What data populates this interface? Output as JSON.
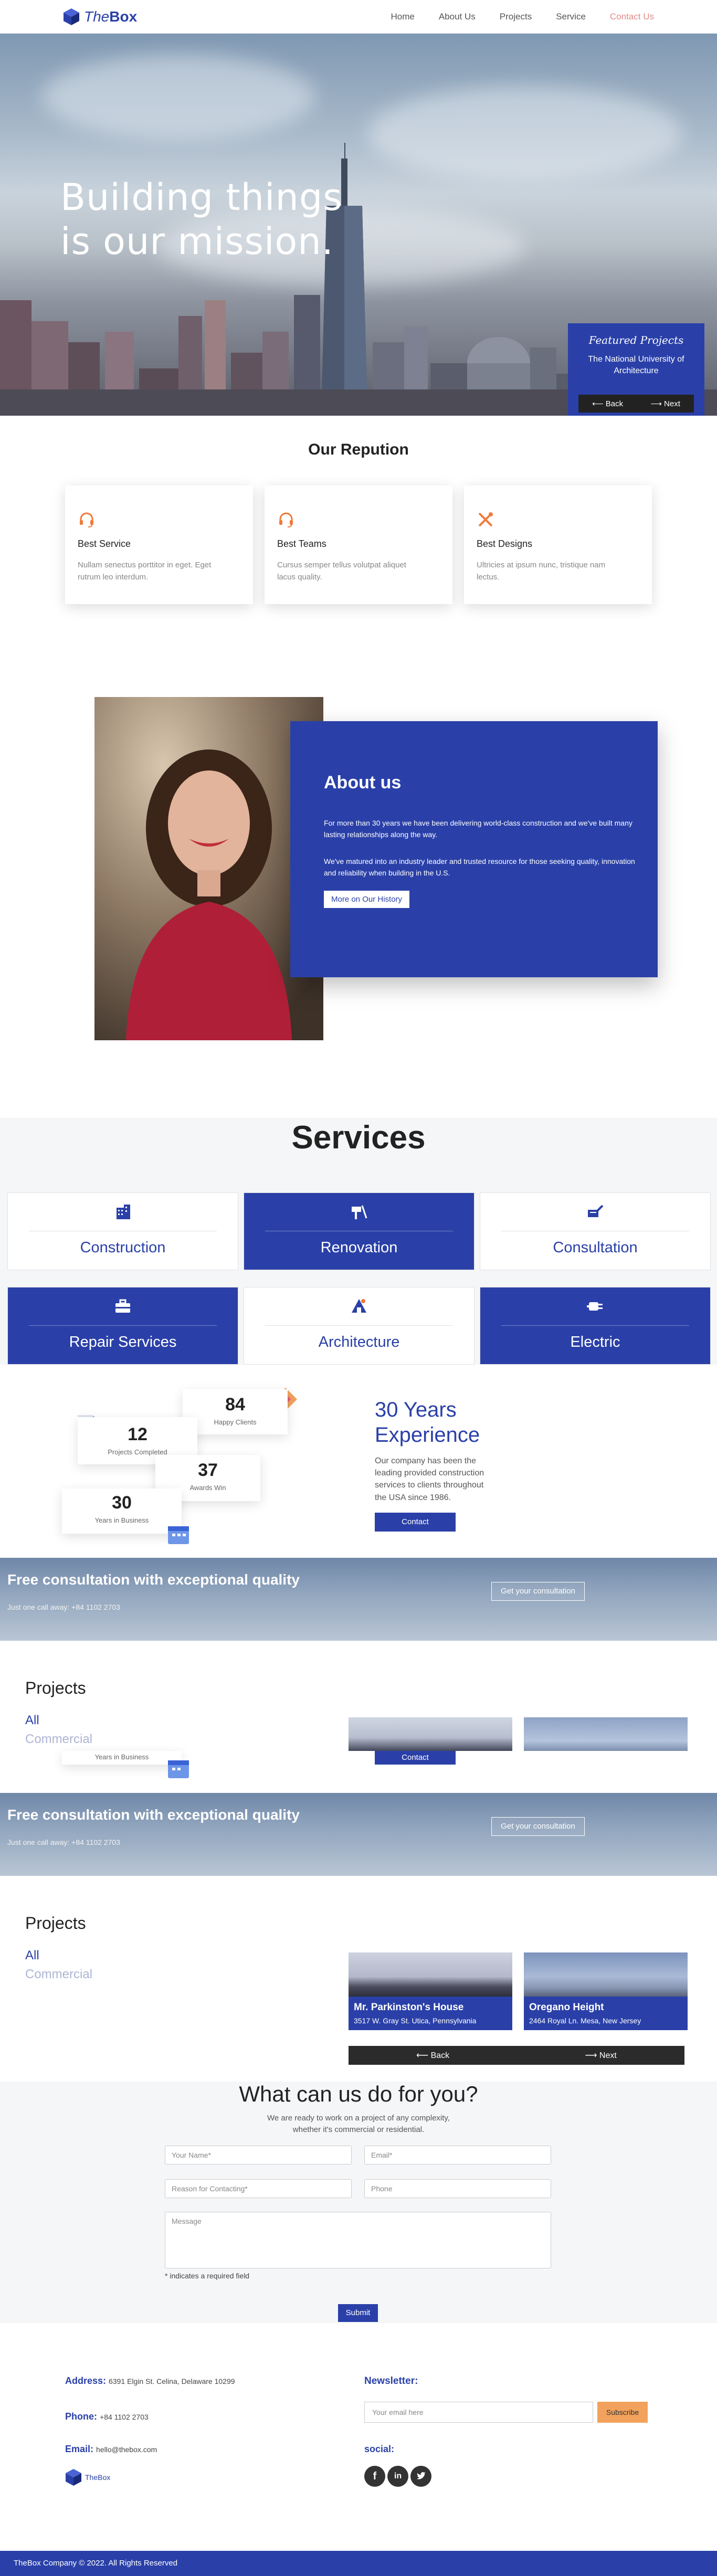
{
  "nav": {
    "logo_the": "The",
    "logo_box": "Box",
    "items": [
      "Home",
      "About Us",
      "Projects",
      "Service",
      "Contact Us"
    ]
  },
  "hero": {
    "line1": "Building things",
    "line2": "is our mission.",
    "slider_title": "Featured Projects",
    "slider_subtitle_1": "The National University of",
    "slider_subtitle_2": "Architecture",
    "back": "Back",
    "next": "Next"
  },
  "reputation": {
    "title": "Our Repution",
    "cards": [
      {
        "title": "Best Service",
        "text": "Nullam senectus porttitor in eget. Eget rutrum leo interdum."
      },
      {
        "title": "Best Teams",
        "text": "Cursus semper tellus volutpat aliquet lacus quality."
      },
      {
        "title": "Best Designs",
        "text": "Ultricies at ipsum nunc, tristique nam lectus."
      }
    ]
  },
  "about": {
    "title": "About us",
    "p1": "For more than 30 years we have been delivering world-class construction and we've built many lasting relationships along the way.",
    "p2": "We've matured into an industry leader and trusted resource for those seeking quality, innovation and reliability when building in the U.S.",
    "button": "More on Our History"
  },
  "services": {
    "title": "Services",
    "items": [
      "Construction",
      "Renovation",
      "Consultation",
      "Repair Services",
      "Architecture",
      "Electric"
    ]
  },
  "stats": {
    "happy_num": "84",
    "happy_label": "Happy Clients",
    "projects_num": "12",
    "projects_label": "Projects Completed",
    "awards_num": "37",
    "awards_label": "Awards Win",
    "years_num": "30",
    "years_label": "Years in Business",
    "heading_1": "30 Years",
    "heading_2": "Experience",
    "text": "Our company has been the leading provided construction services to clients throughout the USA since 1986.",
    "contact": "Contact"
  },
  "banner": {
    "title": "Free consultation with exceptional quality",
    "sub": "Just one call away: +84 1102 2703",
    "button": "Get your consultation"
  },
  "projects": {
    "title": "Projects",
    "filter_all": "All",
    "filter_commercial": "Commercial",
    "items": [
      {
        "name": "Mr. Parkinston's House",
        "address": "3517 W. Gray St. Utica, Pennsylvania"
      },
      {
        "name": "Oregano Height",
        "address": "2464 Royal Ln. Mesa, New Jersey"
      }
    ],
    "back": "Back",
    "next": "Next"
  },
  "contact_form": {
    "title": "What can us do for you?",
    "sub1": "We are ready to work on a project of any complexity,",
    "sub2": "whether it's commercial or residential.",
    "name_ph": "Your Name*",
    "email_ph": "Email*",
    "reason_ph": "Reason for Contacting*",
    "phone_ph": "Phone",
    "message_ph": "Message",
    "required_note": "* indicates a required field",
    "submit": "Submit"
  },
  "footer": {
    "address_label": "Address:",
    "address": "6391 Elgin St. Celina, Delaware 10299",
    "phone_label": "Phone:",
    "phone": "+84 1102 2703",
    "email_label": "Email:",
    "email": "hello@thebox.com",
    "logo_text": "TheBox",
    "newsletter_label": "Newsletter:",
    "newsletter_ph": "Your email here",
    "subscribe": "Subscribe",
    "social_label": "social:",
    "copyright": "TheBox Company © 2022. All Rights Reserved"
  },
  "colors": {
    "brand": "#2a40a8",
    "accent": "#f2a25c",
    "contact_link": "#e58a8a"
  }
}
